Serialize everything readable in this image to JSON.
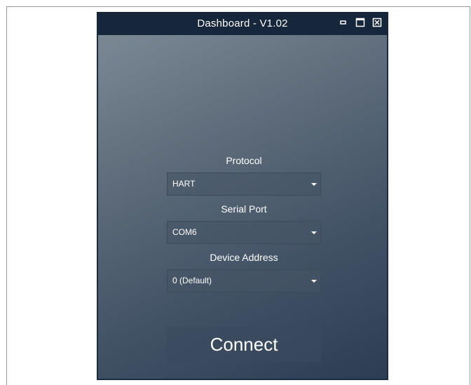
{
  "window": {
    "title": "Dashboard - V1.02",
    "controls": [
      "minimize-icon",
      "maximize-icon",
      "close-icon"
    ]
  },
  "form": {
    "protocol_label": "Protocol",
    "protocol_value": "HART",
    "serial_port_label": "Serial Port",
    "serial_port_value": "COM6",
    "device_address_label": "Device Address",
    "device_address_value": "0 (Default)",
    "connect_label": "Connect"
  },
  "colors": {
    "titlebar": "#16263b",
    "gradient_top": "#7b8894",
    "gradient_bottom": "#2c3d54",
    "text": "#ffffff"
  }
}
